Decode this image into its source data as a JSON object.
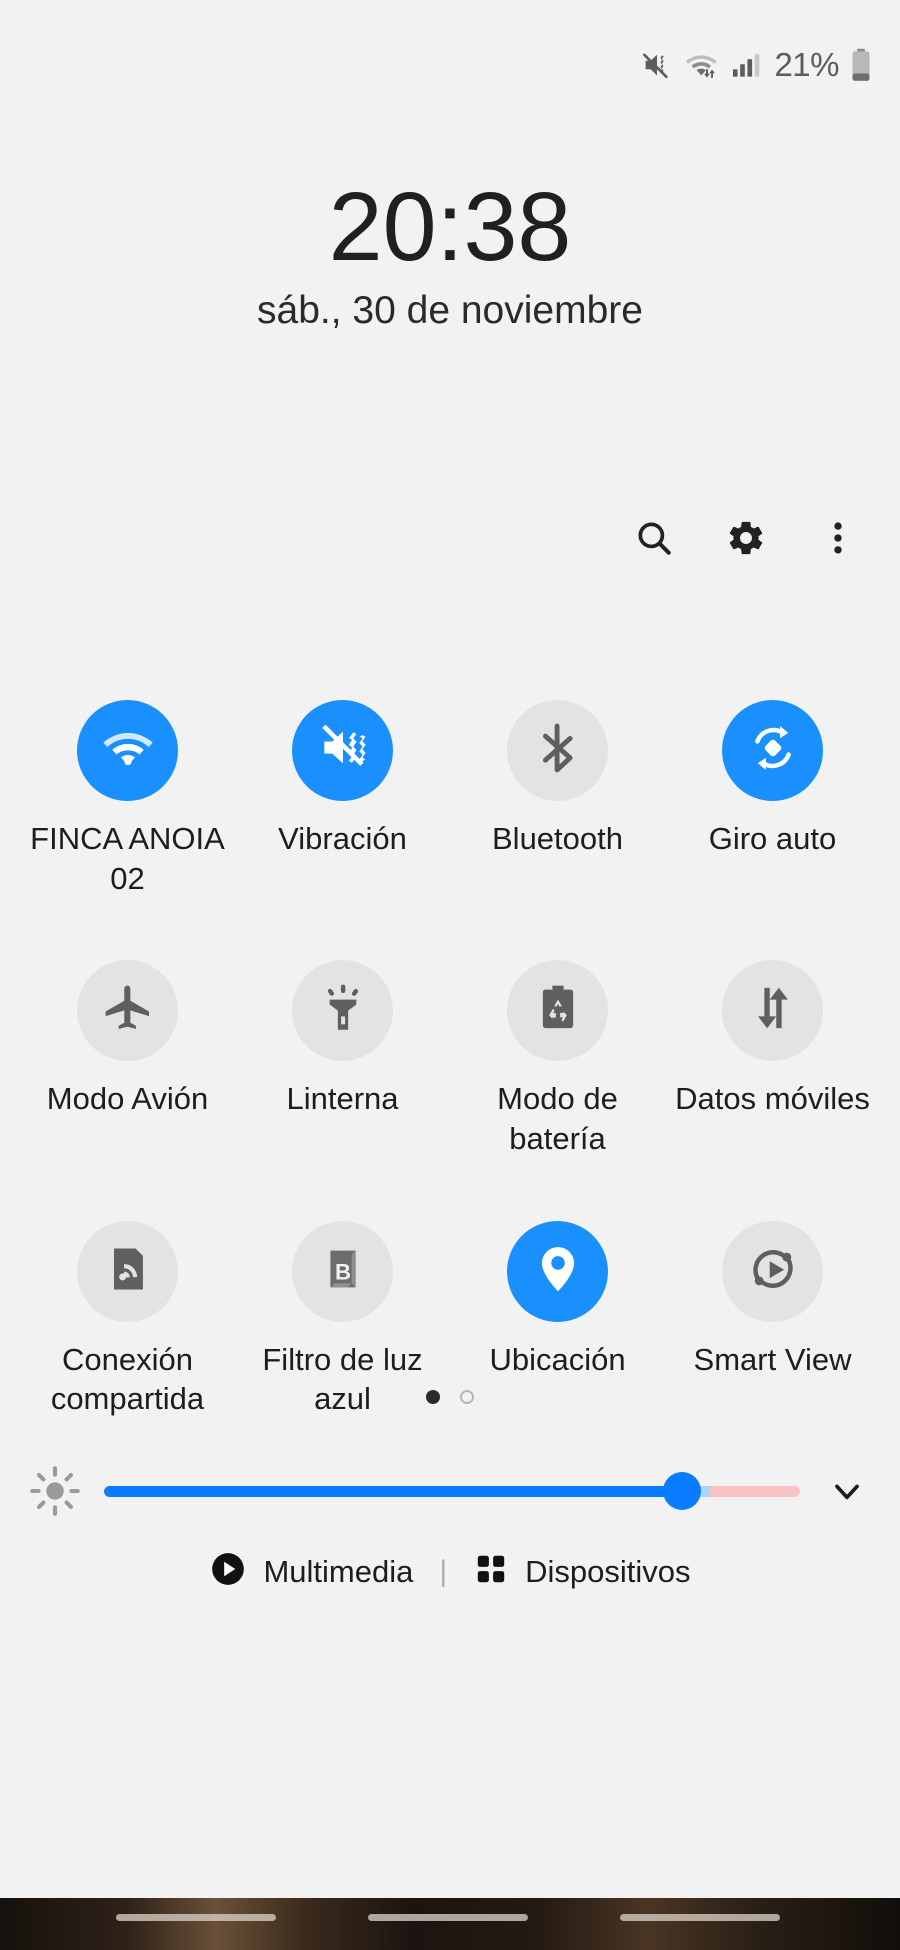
{
  "statusbar": {
    "battery_text": "21%",
    "icons": [
      "mute-vibrate-icon",
      "wifi-data-icon",
      "signal-bars-icon",
      "battery-icon"
    ]
  },
  "header": {
    "clock": "20:38",
    "date": "sáb., 30 de noviembre"
  },
  "actions": [
    {
      "name": "search-button",
      "icon": "search-icon"
    },
    {
      "name": "settings-button",
      "icon": "gear-icon"
    },
    {
      "name": "more-options-button",
      "icon": "overflow-menu-icon"
    }
  ],
  "tiles": [
    {
      "label": "FINCA ANOIA 02",
      "icon": "wifi-icon",
      "active": true
    },
    {
      "label": "Vibración",
      "icon": "vibrate-icon",
      "active": true
    },
    {
      "label": "Bluetooth",
      "icon": "bluetooth-icon",
      "active": false
    },
    {
      "label": "Giro auto",
      "icon": "auto-rotate-icon",
      "active": true
    },
    {
      "label": "Modo Avión",
      "icon": "airplane-icon",
      "active": false
    },
    {
      "label": "Linterna",
      "icon": "flashlight-icon",
      "active": false
    },
    {
      "label": "Modo de batería",
      "icon": "battery-mode-icon",
      "active": false
    },
    {
      "label": "Datos móviles",
      "icon": "mobile-data-icon",
      "active": false
    },
    {
      "label": "Conexión compartida",
      "icon": "hotspot-icon",
      "active": false
    },
    {
      "label": "Filtro de luz azul",
      "icon": "blue-light-filter-icon",
      "active": false
    },
    {
      "label": "Ubicación",
      "icon": "location-pin-icon",
      "active": true
    },
    {
      "label": "Smart View",
      "icon": "smart-view-icon",
      "active": false
    }
  ],
  "pager": {
    "pages": 2,
    "current": 1
  },
  "brightness": {
    "value_percent": 83,
    "left_icon": "brightness-sun-icon",
    "expand_icon": "chevron-down-icon"
  },
  "footer": {
    "media_label": "Multimedia",
    "media_icon": "play-circle-icon",
    "separator": "|",
    "devices_label": "Dispositivos",
    "devices_icon": "devices-grid-icon"
  },
  "colors": {
    "accent": "#1a90ff",
    "slider_fill": "#0a7cff",
    "slider_remainder": "#f8c2c2",
    "tile_off": "#e3e3e3",
    "background": "#f2f2f2"
  }
}
